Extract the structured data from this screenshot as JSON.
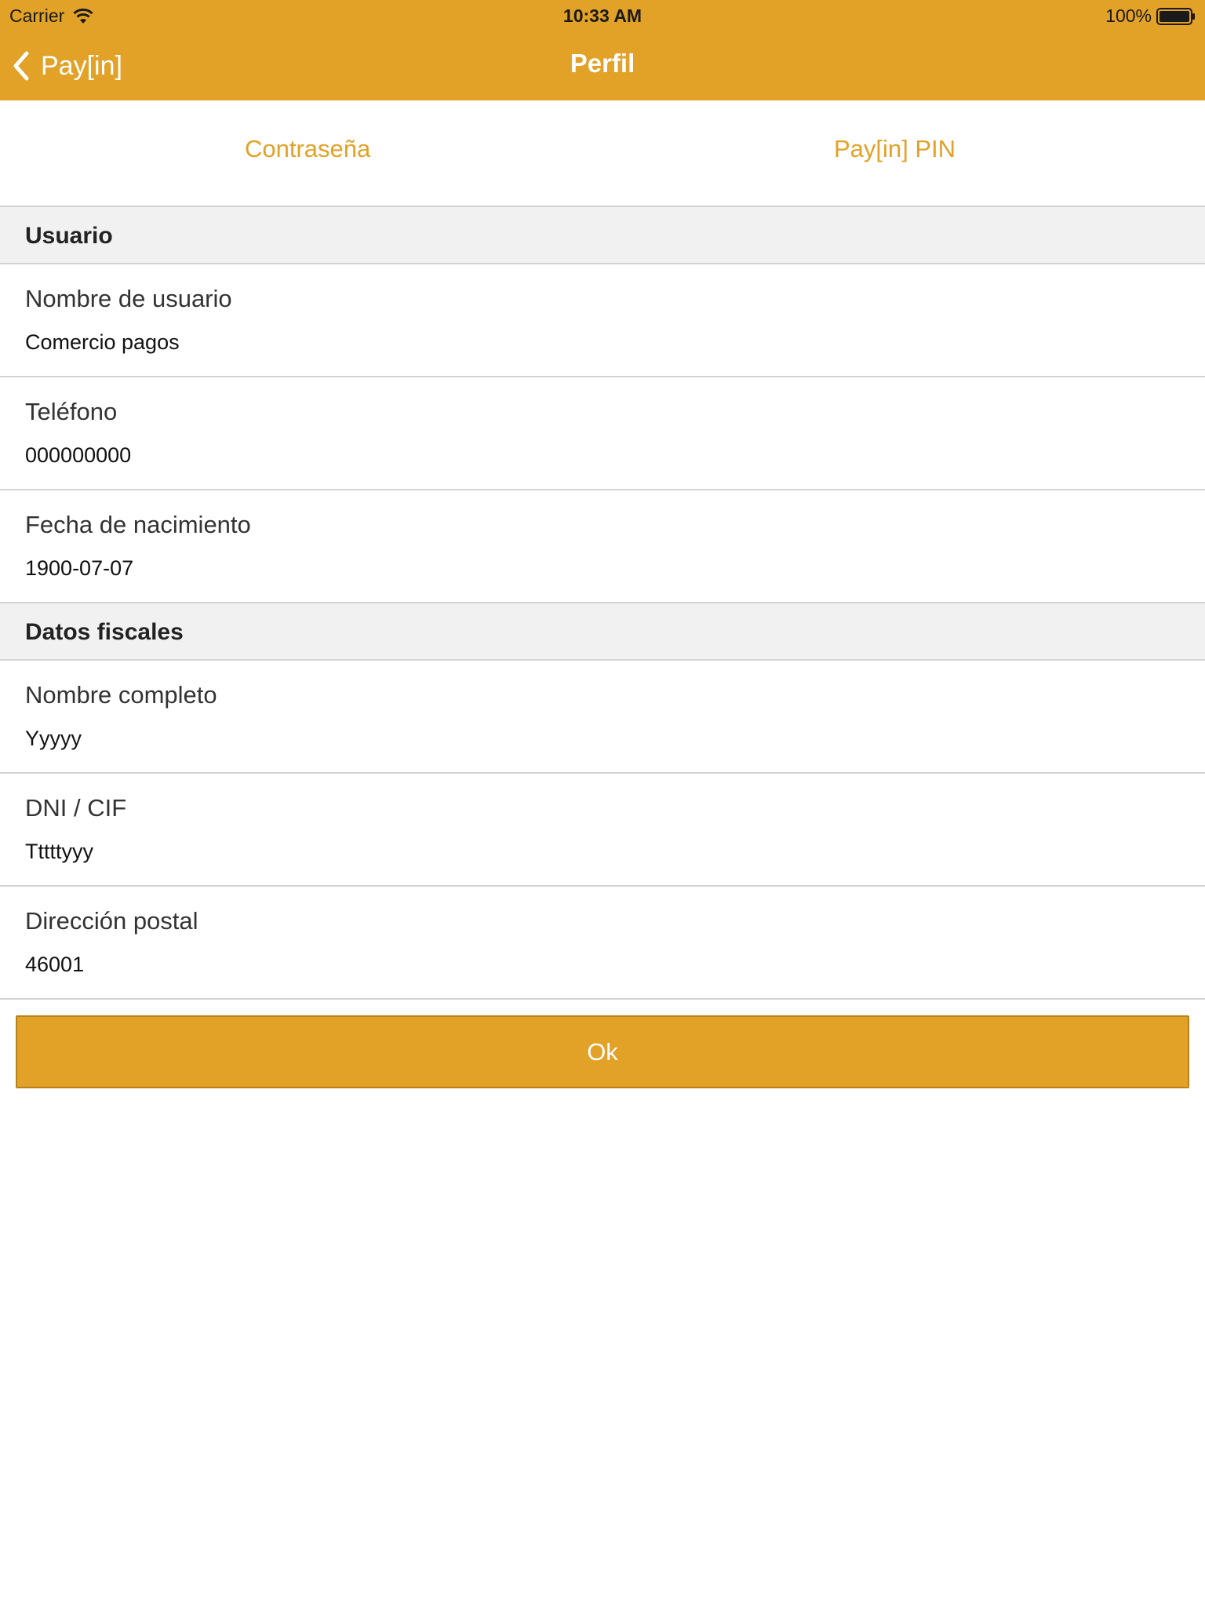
{
  "status_bar": {
    "carrier": "Carrier",
    "time": "10:33 AM",
    "battery": "100%"
  },
  "nav": {
    "back_label": "Pay[in]",
    "title": "Perfil"
  },
  "segments": {
    "password": "Contraseña",
    "pin": "Pay[in] PIN"
  },
  "sections": {
    "user_title": "Usuario",
    "fiscal_title": "Datos fiscales"
  },
  "user_fields": [
    {
      "label": "Nombre de usuario",
      "value": "Comercio pagos"
    },
    {
      "label": "Teléfono",
      "value": "000000000"
    },
    {
      "label": "Fecha de nacimiento",
      "value": "1900-07-07"
    }
  ],
  "fiscal_fields": [
    {
      "label": "Nombre completo",
      "value": "Yyyyy"
    },
    {
      "label": "DNI / CIF",
      "value": "Tttttyyy"
    },
    {
      "label": "Dirección postal",
      "value": "46001"
    }
  ],
  "ok_button": "Ok",
  "colors": {
    "accent": "#e2a127",
    "section_bg": "#f1f1f1",
    "divider": "#d4d4d4"
  },
  "icons": {
    "wifi": "wifi-icon",
    "battery": "battery-icon",
    "back": "chevron-left-icon"
  }
}
